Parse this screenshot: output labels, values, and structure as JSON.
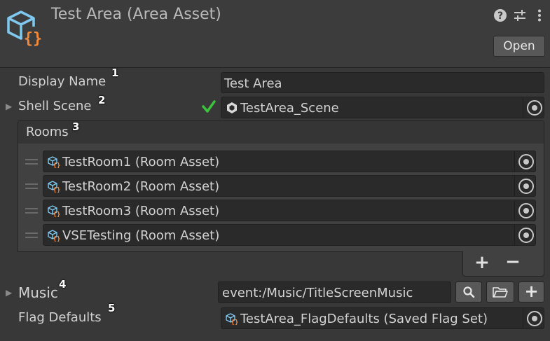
{
  "header": {
    "title": "Test Area (Area Asset)",
    "open_label": "Open",
    "icons": [
      "help-icon",
      "settings-sliders-icon",
      "kebab-menu-icon"
    ]
  },
  "markers": [
    "1",
    "2",
    "3",
    "4",
    "5"
  ],
  "fields": {
    "display_name": {
      "label": "Display Name",
      "value": "Test Area"
    },
    "shell_scene": {
      "label": "Shell Scene",
      "value": "TestArea_Scene",
      "status": "valid-check"
    },
    "rooms": {
      "label": "Rooms",
      "items": [
        {
          "label": "TestRoom1 (Room Asset)"
        },
        {
          "label": "TestRoom2 (Room Asset)"
        },
        {
          "label": "TestRoom3 (Room Asset)"
        },
        {
          "label": "VSETesting (Room Asset)"
        }
      ]
    },
    "music": {
      "label": "Music",
      "value": "event:/Music/TitleScreenMusic"
    },
    "flag_defaults": {
      "label": "Flag Defaults",
      "value": "TestArea_FlagDefaults (Saved Flag Set)"
    }
  },
  "colors": {
    "check": "#3cc23c",
    "icon_blue": "#7fc8f0",
    "icon_orange": "#f08a3c"
  }
}
